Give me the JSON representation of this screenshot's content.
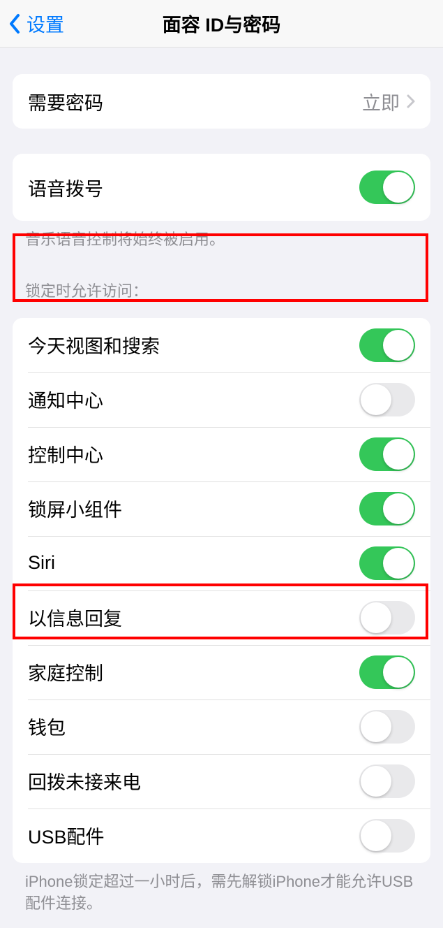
{
  "navbar": {
    "back_label": "设置",
    "title": "面容 ID与密码"
  },
  "require_passcode": {
    "label": "需要密码",
    "value": "立即"
  },
  "voice_dial": {
    "label": "语音拨号",
    "on": true,
    "footer": "音乐语音控制将始终被启用。"
  },
  "lock_access_header": "锁定时允许访问：",
  "lock_access": [
    {
      "label": "今天视图和搜索",
      "on": true,
      "key": "today-view"
    },
    {
      "label": "通知中心",
      "on": false,
      "key": "notification-center"
    },
    {
      "label": "控制中心",
      "on": true,
      "key": "control-center"
    },
    {
      "label": "锁屏小组件",
      "on": true,
      "key": "lock-screen-widgets"
    },
    {
      "label": "Siri",
      "on": true,
      "key": "siri"
    },
    {
      "label": "以信息回复",
      "on": false,
      "key": "reply-with-message"
    },
    {
      "label": "家庭控制",
      "on": true,
      "key": "home-control"
    },
    {
      "label": "钱包",
      "on": false,
      "key": "wallet"
    },
    {
      "label": "回拨未接来电",
      "on": false,
      "key": "return-missed-calls"
    },
    {
      "label": "USB配件",
      "on": false,
      "key": "usb-accessories"
    }
  ],
  "usb_footer": "iPhone锁定超过一小时后，需先解锁iPhone才能允许USB配件连接。"
}
